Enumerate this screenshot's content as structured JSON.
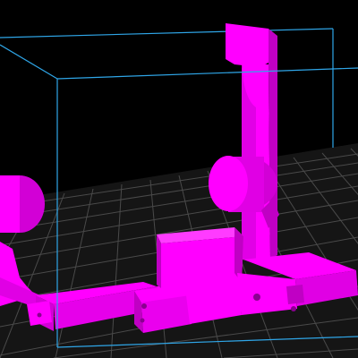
{
  "viewport": {
    "background_color": "#000000",
    "grid_line_color": "#4a4a4a",
    "grid_fill_color": "#1a1a1a",
    "build_volume_edge_color": "#2fa6e8",
    "model_color": "#ff00ff",
    "model_shadow_color": "#c000c4",
    "model_dark_color": "#8a0090"
  }
}
